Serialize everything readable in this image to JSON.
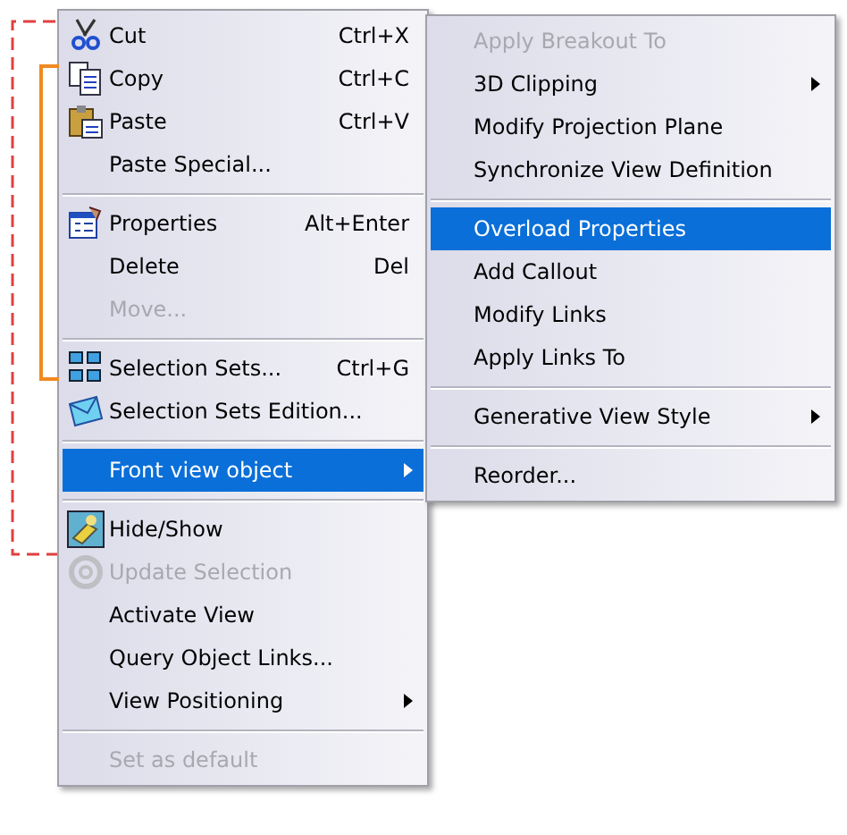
{
  "context_menu": {
    "items": [
      {
        "kind": "item",
        "label": "Cut",
        "shortcut": "Ctrl+X",
        "disabled": false,
        "selected": false,
        "submenu": false
      },
      {
        "kind": "item",
        "label": "Copy",
        "shortcut": "Ctrl+C",
        "disabled": false,
        "selected": false,
        "submenu": false
      },
      {
        "kind": "item",
        "label": "Paste",
        "shortcut": "Ctrl+V",
        "disabled": false,
        "selected": false,
        "submenu": false
      },
      {
        "kind": "item",
        "label": "Paste Special...",
        "disabled": false,
        "selected": false,
        "submenu": false
      },
      {
        "kind": "separator"
      },
      {
        "kind": "item",
        "label": "Properties",
        "shortcut": "Alt+Enter",
        "disabled": false,
        "selected": false,
        "submenu": false
      },
      {
        "kind": "item",
        "label": "Delete",
        "shortcut": "Del",
        "disabled": false,
        "selected": false,
        "submenu": false
      },
      {
        "kind": "item",
        "label": "Move...",
        "disabled": true,
        "selected": false,
        "submenu": false
      },
      {
        "kind": "separator"
      },
      {
        "kind": "item",
        "label": "Selection Sets...",
        "shortcut": "Ctrl+G",
        "disabled": false,
        "selected": false,
        "submenu": false
      },
      {
        "kind": "item",
        "label": "Selection Sets Edition...",
        "disabled": false,
        "selected": false,
        "submenu": false
      },
      {
        "kind": "separator"
      },
      {
        "kind": "item",
        "label": "Front view object",
        "disabled": false,
        "selected": true,
        "submenu": true
      },
      {
        "kind": "separator"
      },
      {
        "kind": "item",
        "label": "Hide/Show",
        "disabled": false,
        "selected": false,
        "submenu": false
      },
      {
        "kind": "item",
        "label": "Update Selection",
        "disabled": true,
        "selected": false,
        "submenu": false
      },
      {
        "kind": "item",
        "label": "Activate View",
        "disabled": false,
        "selected": false,
        "submenu": false
      },
      {
        "kind": "item",
        "label": "Query Object Links...",
        "disabled": false,
        "selected": false,
        "submenu": false
      },
      {
        "kind": "item",
        "label": "View Positioning",
        "disabled": false,
        "selected": false,
        "submenu": true
      },
      {
        "kind": "separator"
      },
      {
        "kind": "item",
        "label": "Set as default",
        "disabled": true,
        "selected": false,
        "submenu": false
      }
    ]
  },
  "submenu": {
    "items": [
      {
        "kind": "item",
        "label": "Apply Breakout To",
        "disabled": true,
        "selected": false,
        "submenu": false
      },
      {
        "kind": "item",
        "label": "3D Clipping",
        "disabled": false,
        "selected": false,
        "submenu": true
      },
      {
        "kind": "item",
        "label": "Modify Projection Plane",
        "disabled": false,
        "selected": false,
        "submenu": false
      },
      {
        "kind": "item",
        "label": "Synchronize View Definition",
        "disabled": false,
        "selected": false,
        "submenu": false
      },
      {
        "kind": "separator"
      },
      {
        "kind": "item",
        "label": "Overload Properties",
        "disabled": false,
        "selected": true,
        "submenu": false
      },
      {
        "kind": "item",
        "label": "Add Callout",
        "disabled": false,
        "selected": false,
        "submenu": false
      },
      {
        "kind": "item",
        "label": "Modify Links",
        "disabled": false,
        "selected": false,
        "submenu": false
      },
      {
        "kind": "item",
        "label": "Apply Links To",
        "disabled": false,
        "selected": false,
        "submenu": false
      },
      {
        "kind": "separator"
      },
      {
        "kind": "item",
        "label": "Generative View Style",
        "disabled": false,
        "selected": false,
        "submenu": true
      },
      {
        "kind": "separator"
      },
      {
        "kind": "item",
        "label": "Reorder...",
        "disabled": false,
        "selected": false,
        "submenu": false
      }
    ]
  }
}
